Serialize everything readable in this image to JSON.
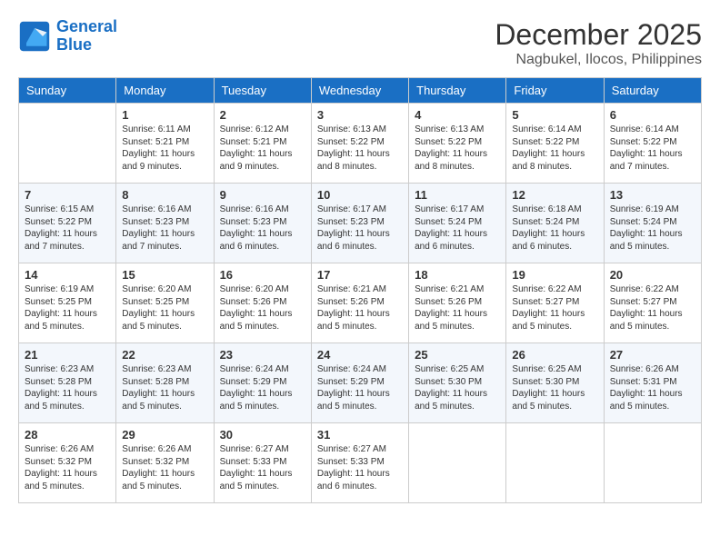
{
  "header": {
    "logo_line1": "General",
    "logo_line2": "Blue",
    "month": "December 2025",
    "location": "Nagbukel, Ilocos, Philippines"
  },
  "days_of_week": [
    "Sunday",
    "Monday",
    "Tuesday",
    "Wednesday",
    "Thursday",
    "Friday",
    "Saturday"
  ],
  "weeks": [
    [
      {
        "day": "",
        "info": ""
      },
      {
        "day": "1",
        "info": "Sunrise: 6:11 AM\nSunset: 5:21 PM\nDaylight: 11 hours\nand 9 minutes."
      },
      {
        "day": "2",
        "info": "Sunrise: 6:12 AM\nSunset: 5:21 PM\nDaylight: 11 hours\nand 9 minutes."
      },
      {
        "day": "3",
        "info": "Sunrise: 6:13 AM\nSunset: 5:22 PM\nDaylight: 11 hours\nand 8 minutes."
      },
      {
        "day": "4",
        "info": "Sunrise: 6:13 AM\nSunset: 5:22 PM\nDaylight: 11 hours\nand 8 minutes."
      },
      {
        "day": "5",
        "info": "Sunrise: 6:14 AM\nSunset: 5:22 PM\nDaylight: 11 hours\nand 8 minutes."
      },
      {
        "day": "6",
        "info": "Sunrise: 6:14 AM\nSunset: 5:22 PM\nDaylight: 11 hours\nand 7 minutes."
      }
    ],
    [
      {
        "day": "7",
        "info": "Sunrise: 6:15 AM\nSunset: 5:22 PM\nDaylight: 11 hours\nand 7 minutes."
      },
      {
        "day": "8",
        "info": "Sunrise: 6:16 AM\nSunset: 5:23 PM\nDaylight: 11 hours\nand 7 minutes."
      },
      {
        "day": "9",
        "info": "Sunrise: 6:16 AM\nSunset: 5:23 PM\nDaylight: 11 hours\nand 6 minutes."
      },
      {
        "day": "10",
        "info": "Sunrise: 6:17 AM\nSunset: 5:23 PM\nDaylight: 11 hours\nand 6 minutes."
      },
      {
        "day": "11",
        "info": "Sunrise: 6:17 AM\nSunset: 5:24 PM\nDaylight: 11 hours\nand 6 minutes."
      },
      {
        "day": "12",
        "info": "Sunrise: 6:18 AM\nSunset: 5:24 PM\nDaylight: 11 hours\nand 6 minutes."
      },
      {
        "day": "13",
        "info": "Sunrise: 6:19 AM\nSunset: 5:24 PM\nDaylight: 11 hours\nand 5 minutes."
      }
    ],
    [
      {
        "day": "14",
        "info": "Sunrise: 6:19 AM\nSunset: 5:25 PM\nDaylight: 11 hours\nand 5 minutes."
      },
      {
        "day": "15",
        "info": "Sunrise: 6:20 AM\nSunset: 5:25 PM\nDaylight: 11 hours\nand 5 minutes."
      },
      {
        "day": "16",
        "info": "Sunrise: 6:20 AM\nSunset: 5:26 PM\nDaylight: 11 hours\nand 5 minutes."
      },
      {
        "day": "17",
        "info": "Sunrise: 6:21 AM\nSunset: 5:26 PM\nDaylight: 11 hours\nand 5 minutes."
      },
      {
        "day": "18",
        "info": "Sunrise: 6:21 AM\nSunset: 5:26 PM\nDaylight: 11 hours\nand 5 minutes."
      },
      {
        "day": "19",
        "info": "Sunrise: 6:22 AM\nSunset: 5:27 PM\nDaylight: 11 hours\nand 5 minutes."
      },
      {
        "day": "20",
        "info": "Sunrise: 6:22 AM\nSunset: 5:27 PM\nDaylight: 11 hours\nand 5 minutes."
      }
    ],
    [
      {
        "day": "21",
        "info": "Sunrise: 6:23 AM\nSunset: 5:28 PM\nDaylight: 11 hours\nand 5 minutes."
      },
      {
        "day": "22",
        "info": "Sunrise: 6:23 AM\nSunset: 5:28 PM\nDaylight: 11 hours\nand 5 minutes."
      },
      {
        "day": "23",
        "info": "Sunrise: 6:24 AM\nSunset: 5:29 PM\nDaylight: 11 hours\nand 5 minutes."
      },
      {
        "day": "24",
        "info": "Sunrise: 6:24 AM\nSunset: 5:29 PM\nDaylight: 11 hours\nand 5 minutes."
      },
      {
        "day": "25",
        "info": "Sunrise: 6:25 AM\nSunset: 5:30 PM\nDaylight: 11 hours\nand 5 minutes."
      },
      {
        "day": "26",
        "info": "Sunrise: 6:25 AM\nSunset: 5:30 PM\nDaylight: 11 hours\nand 5 minutes."
      },
      {
        "day": "27",
        "info": "Sunrise: 6:26 AM\nSunset: 5:31 PM\nDaylight: 11 hours\nand 5 minutes."
      }
    ],
    [
      {
        "day": "28",
        "info": "Sunrise: 6:26 AM\nSunset: 5:32 PM\nDaylight: 11 hours\nand 5 minutes."
      },
      {
        "day": "29",
        "info": "Sunrise: 6:26 AM\nSunset: 5:32 PM\nDaylight: 11 hours\nand 5 minutes."
      },
      {
        "day": "30",
        "info": "Sunrise: 6:27 AM\nSunset: 5:33 PM\nDaylight: 11 hours\nand 5 minutes."
      },
      {
        "day": "31",
        "info": "Sunrise: 6:27 AM\nSunset: 5:33 PM\nDaylight: 11 hours\nand 6 minutes."
      },
      {
        "day": "",
        "info": ""
      },
      {
        "day": "",
        "info": ""
      },
      {
        "day": "",
        "info": ""
      }
    ]
  ]
}
